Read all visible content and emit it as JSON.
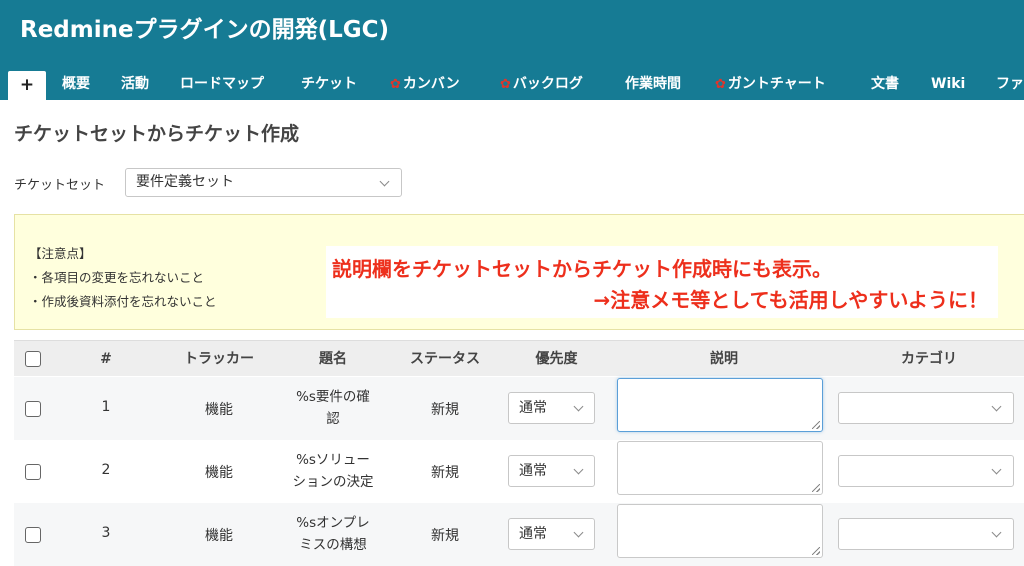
{
  "project": {
    "title": "Redmineプラグインの開発(LGC)"
  },
  "menu": {
    "new_tab": "+",
    "items": [
      "概要",
      "活動",
      "ロードマップ",
      "チケット",
      "カンバン",
      "バックログ",
      "作業時間",
      "ガントチャート",
      "文書",
      "Wiki",
      "ファ"
    ]
  },
  "page": {
    "title": "チケットセットからチケット作成"
  },
  "ticket_set": {
    "label": "チケットセット",
    "selected": "要件定義セット"
  },
  "notice": {
    "heading": "【注意点】",
    "lines": [
      "・各項目の変更を忘れないこと",
      "・作成後資料添付を忘れないこと"
    ]
  },
  "callout": {
    "line1": "説明欄をチケットセットからチケット作成時にも表示。",
    "line2": "→注意メモ等としても活用しやすいように！",
    "color": "#ed2f1c"
  },
  "table": {
    "headers": {
      "number": "#",
      "tracker": "トラッカー",
      "subject": "題名",
      "status": "ステータス",
      "priority": "優先度",
      "description": "説明",
      "category": "カテゴリ"
    },
    "rows": [
      {
        "number": "1",
        "tracker": "機能",
        "subject_line1": "%s要件の確",
        "subject_line2": "認",
        "status": "新規",
        "priority": "通常",
        "description": "",
        "category": ""
      },
      {
        "number": "2",
        "tracker": "機能",
        "subject_line1": "%sソリュー",
        "subject_line2": "ションの決定",
        "status": "新規",
        "priority": "通常",
        "description": "",
        "category": ""
      },
      {
        "number": "3",
        "tracker": "機能",
        "subject_line1": "%sオンプレ",
        "subject_line2": "ミスの構想",
        "status": "新規",
        "priority": "通常",
        "description": "",
        "category": ""
      }
    ]
  },
  "colors": {
    "header_bg": "#167b94",
    "notice_bg": "#ffffdd",
    "focus_border": "#5b9fd8"
  }
}
